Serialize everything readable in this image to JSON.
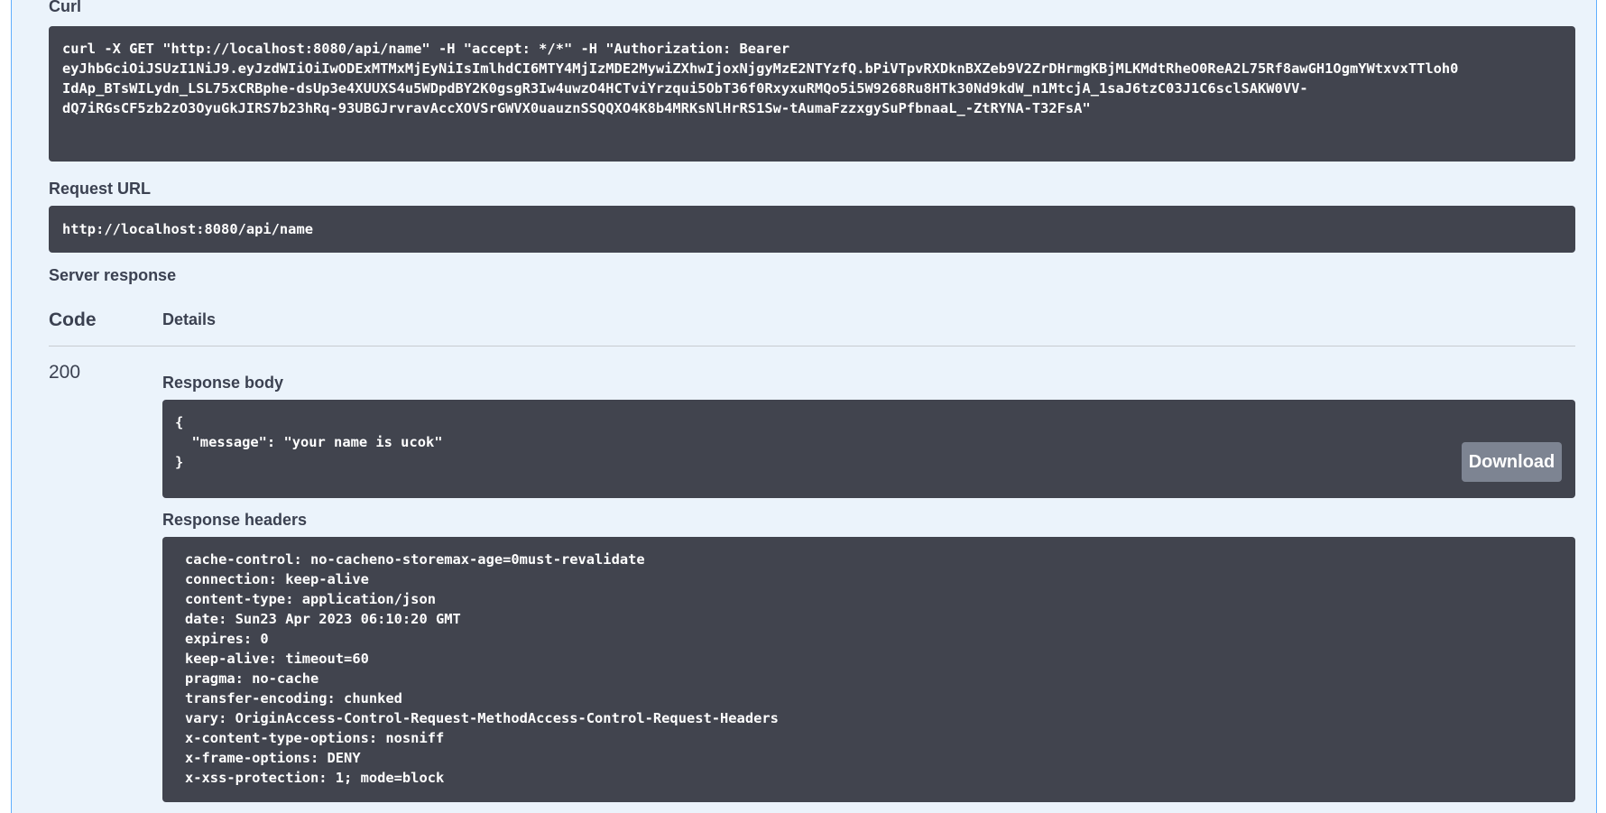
{
  "curl": {
    "label": "Curl",
    "lines": [
      "curl -X GET \"http://localhost:8080/api/name\" -H \"accept: */*\" -H \"Authorization: Bearer",
      "eyJhbGciOiJSUzI1NiJ9.eyJzdWIiOiIwODExMTMxMjEyNiIsImlhdCI6MTY4MjIzMDE2MywiZXhwIjoxNjgyMzE2NTYzfQ.bPiVTpvRXDknBXZeb9V2ZrDHrmgKBjMLKMdtRheO0ReA2L75Rf8awGH1OgmYWtxvxTTloh0",
      "IdAp_BTsWILydn_LSL75xCRBphe-dsUp3e4XUUXS4u5WDpdBY2K0gsgR3Iw4uwzO4HCTviYrzqui5ObT36f0RxyxuRMQo5i5W9268Ru8HTk30Nd9kdW_n1MtcjA_1saJ6tzC03J1C6sclSAKW0VV-",
      "dQ7iRGsCF5zb2zO3OyuGkJIRS7b23hRq-93UBGJrvravAccXOVSrGWVX0uauznSSQQXO4K8b4MRKsNlHrRS1Sw-tAumaFzzxgySuPfbnaaL_-ZtRYNA-T32FsA\""
    ]
  },
  "request_url": {
    "label": "Request URL",
    "value": "http://localhost:8080/api/name"
  },
  "server_response": {
    "label": "Server response",
    "code_header": "Code",
    "details_header": "Details",
    "code": "200",
    "response_body_label": "Response body",
    "response_body_lines": [
      "{",
      "  \"message\": \"your name is ucok\"",
      "}"
    ],
    "download_label": "Download",
    "response_headers_label": "Response headers",
    "headers": [
      " cache-control: no-cacheno-storemax-age=0must-revalidate ",
      " connection: keep-alive ",
      " content-type: application/json ",
      " date: Sun23 Apr 2023 06:10:20 GMT ",
      " expires: 0 ",
      " keep-alive: timeout=60 ",
      " pragma: no-cache ",
      " transfer-encoding: chunked ",
      " vary: OriginAccess-Control-Request-MethodAccess-Control-Request-Headers ",
      " x-content-type-options: nosniff ",
      " x-frame-options: DENY ",
      " x-xss-protection: 1; mode=block "
    ]
  },
  "colors": {
    "panel_bg": "#ebf3fb",
    "panel_border": "#61affe",
    "code_block_bg": "#41444e",
    "download_button_bg": "#7d8492",
    "text": "#3b4151"
  }
}
